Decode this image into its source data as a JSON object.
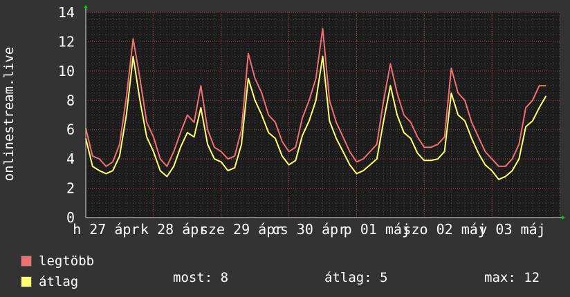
{
  "chart_data": {
    "type": "line",
    "ylabel": "onlinestream.live",
    "ylim": [
      0,
      14
    ],
    "yticks": [
      0,
      2,
      4,
      6,
      8,
      10,
      12,
      14
    ],
    "xlim": [
      0,
      7.0
    ],
    "xticks": [
      {
        "x": 0.3,
        "label": "h 27 ápr"
      },
      {
        "x": 1.3,
        "label": "k 28 ápr"
      },
      {
        "x": 2.3,
        "label": "sze 29 ápr"
      },
      {
        "x": 3.3,
        "label": "cs 30 ápr"
      },
      {
        "x": 4.3,
        "label": "p 01 máj"
      },
      {
        "x": 5.3,
        "label": "szo 02 máj"
      },
      {
        "x": 6.3,
        "label": "v 03 máj"
      }
    ],
    "grid": true,
    "series": [
      {
        "name": "legtöbb",
        "color": "#ee7070",
        "points": [
          [
            0.0,
            6.1
          ],
          [
            0.1,
            4.2
          ],
          [
            0.2,
            4.0
          ],
          [
            0.3,
            3.5
          ],
          [
            0.4,
            3.8
          ],
          [
            0.5,
            5.0
          ],
          [
            0.6,
            8.2
          ],
          [
            0.7,
            12.2
          ],
          [
            0.8,
            9.5
          ],
          [
            0.9,
            6.5
          ],
          [
            1.0,
            5.5
          ],
          [
            1.1,
            4.0
          ],
          [
            1.2,
            3.5
          ],
          [
            1.3,
            4.5
          ],
          [
            1.4,
            5.8
          ],
          [
            1.5,
            7.0
          ],
          [
            1.6,
            6.5
          ],
          [
            1.7,
            9.0
          ],
          [
            1.8,
            6.0
          ],
          [
            1.9,
            4.8
          ],
          [
            2.0,
            4.5
          ],
          [
            2.1,
            4.0
          ],
          [
            2.2,
            4.2
          ],
          [
            2.3,
            6.0
          ],
          [
            2.4,
            11.2
          ],
          [
            2.5,
            9.5
          ],
          [
            2.6,
            8.5
          ],
          [
            2.7,
            7.0
          ],
          [
            2.8,
            6.5
          ],
          [
            2.9,
            5.2
          ],
          [
            3.0,
            4.5
          ],
          [
            3.1,
            4.8
          ],
          [
            3.2,
            6.8
          ],
          [
            3.3,
            8.0
          ],
          [
            3.4,
            9.5
          ],
          [
            3.5,
            12.9
          ],
          [
            3.6,
            8.0
          ],
          [
            3.7,
            6.5
          ],
          [
            3.8,
            5.5
          ],
          [
            3.9,
            4.5
          ],
          [
            4.0,
            3.8
          ],
          [
            4.1,
            4.0
          ],
          [
            4.2,
            4.5
          ],
          [
            4.3,
            5.0
          ],
          [
            4.4,
            8.0
          ],
          [
            4.5,
            10.5
          ],
          [
            4.6,
            8.5
          ],
          [
            4.7,
            7.0
          ],
          [
            4.8,
            6.5
          ],
          [
            4.9,
            5.5
          ],
          [
            5.0,
            4.8
          ],
          [
            5.1,
            4.8
          ],
          [
            5.2,
            5.0
          ],
          [
            5.3,
            5.5
          ],
          [
            5.4,
            10.2
          ],
          [
            5.5,
            8.5
          ],
          [
            5.6,
            8.0
          ],
          [
            5.7,
            6.5
          ],
          [
            5.8,
            5.5
          ],
          [
            5.9,
            4.5
          ],
          [
            6.0,
            4.0
          ],
          [
            6.1,
            3.5
          ],
          [
            6.2,
            3.5
          ],
          [
            6.3,
            4.0
          ],
          [
            6.4,
            5.0
          ],
          [
            6.5,
            7.5
          ],
          [
            6.6,
            8.0
          ],
          [
            6.7,
            9.0
          ],
          [
            6.8,
            9.0
          ]
        ]
      },
      {
        "name": "átlag",
        "color": "#ffff70",
        "points": [
          [
            0.0,
            5.4
          ],
          [
            0.1,
            3.5
          ],
          [
            0.2,
            3.2
          ],
          [
            0.3,
            3.0
          ],
          [
            0.4,
            3.2
          ],
          [
            0.5,
            4.2
          ],
          [
            0.6,
            7.0
          ],
          [
            0.7,
            11.0
          ],
          [
            0.8,
            8.0
          ],
          [
            0.9,
            5.5
          ],
          [
            1.0,
            4.5
          ],
          [
            1.1,
            3.2
          ],
          [
            1.2,
            2.8
          ],
          [
            1.3,
            3.5
          ],
          [
            1.4,
            4.8
          ],
          [
            1.5,
            5.8
          ],
          [
            1.6,
            5.5
          ],
          [
            1.7,
            7.5
          ],
          [
            1.8,
            5.0
          ],
          [
            1.9,
            4.0
          ],
          [
            2.0,
            3.8
          ],
          [
            2.1,
            3.2
          ],
          [
            2.2,
            3.4
          ],
          [
            2.3,
            5.0
          ],
          [
            2.4,
            9.5
          ],
          [
            2.5,
            8.0
          ],
          [
            2.6,
            7.0
          ],
          [
            2.7,
            5.8
          ],
          [
            2.8,
            5.4
          ],
          [
            2.9,
            4.2
          ],
          [
            3.0,
            3.6
          ],
          [
            3.1,
            3.9
          ],
          [
            3.2,
            5.6
          ],
          [
            3.3,
            6.6
          ],
          [
            3.4,
            8.0
          ],
          [
            3.5,
            11.0
          ],
          [
            3.6,
            6.6
          ],
          [
            3.7,
            5.4
          ],
          [
            3.8,
            4.5
          ],
          [
            3.9,
            3.6
          ],
          [
            4.0,
            3.0
          ],
          [
            4.1,
            3.2
          ],
          [
            4.2,
            3.6
          ],
          [
            4.3,
            4.0
          ],
          [
            4.4,
            6.6
          ],
          [
            4.5,
            9.0
          ],
          [
            4.6,
            7.0
          ],
          [
            4.7,
            5.8
          ],
          [
            4.8,
            5.4
          ],
          [
            4.9,
            4.4
          ],
          [
            5.0,
            3.9
          ],
          [
            5.1,
            3.9
          ],
          [
            5.2,
            4.0
          ],
          [
            5.3,
            4.5
          ],
          [
            5.4,
            8.5
          ],
          [
            5.5,
            7.0
          ],
          [
            5.6,
            6.6
          ],
          [
            5.7,
            5.4
          ],
          [
            5.8,
            4.4
          ],
          [
            5.9,
            3.6
          ],
          [
            6.0,
            3.2
          ],
          [
            6.1,
            2.6
          ],
          [
            6.2,
            2.8
          ],
          [
            6.3,
            3.2
          ],
          [
            6.4,
            4.0
          ],
          [
            6.5,
            6.2
          ],
          [
            6.6,
            6.6
          ],
          [
            6.7,
            7.5
          ],
          [
            6.8,
            8.3
          ]
        ]
      }
    ]
  },
  "legend": [
    {
      "label": "legtöbb",
      "color": "#ee7070"
    },
    {
      "label": "átlag",
      "color": "#ffff70"
    }
  ],
  "stats": {
    "now": "most: 8",
    "avg": "átlag: 5",
    "max": "max: 12"
  }
}
